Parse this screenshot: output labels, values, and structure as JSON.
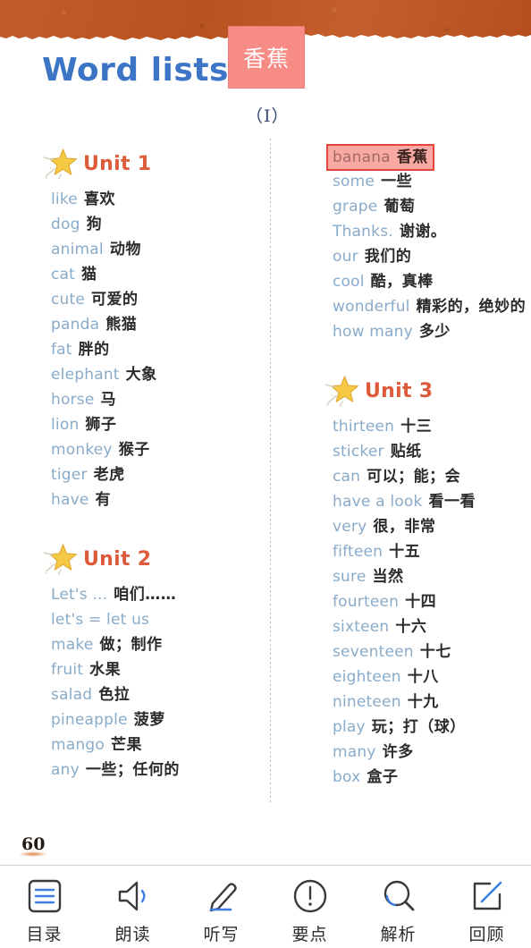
{
  "header": {
    "title": "Word lists",
    "volume_marker": "（Ⅰ）",
    "band_color": "#bc5627",
    "title_color": "#3c74c6"
  },
  "tooltip": {
    "text": "香蕉",
    "bg_color": "#f78c86",
    "text_color": "#ffffff"
  },
  "page": {
    "number": "60"
  },
  "columns": {
    "left": [
      {
        "unit_label": "Unit 1",
        "star_icon": "star-icon",
        "words": [
          {
            "en": "like",
            "zh": "喜欢"
          },
          {
            "en": "dog",
            "zh": "狗"
          },
          {
            "en": "animal",
            "zh": "动物"
          },
          {
            "en": "cat",
            "zh": "猫"
          },
          {
            "en": "cute",
            "zh": "可爱的"
          },
          {
            "en": "panda",
            "zh": "熊猫"
          },
          {
            "en": "fat",
            "zh": "胖的"
          },
          {
            "en": "elephant",
            "zh": "大象"
          },
          {
            "en": "horse",
            "zh": "马"
          },
          {
            "en": "lion",
            "zh": "狮子"
          },
          {
            "en": "monkey",
            "zh": "猴子"
          },
          {
            "en": "tiger",
            "zh": "老虎"
          },
          {
            "en": "have",
            "zh": "有"
          }
        ]
      },
      {
        "unit_label": "Unit 2",
        "star_icon": "star-icon",
        "words": [
          {
            "en": "Let's ...",
            "zh": "咱们……"
          },
          {
            "en": "let's = let us",
            "zh": ""
          },
          {
            "en": "make",
            "zh": "做；制作"
          },
          {
            "en": "fruit",
            "zh": "水果"
          },
          {
            "en": "salad",
            "zh": "色拉"
          },
          {
            "en": "pineapple",
            "zh": "菠萝"
          },
          {
            "en": "mango",
            "zh": "芒果"
          },
          {
            "en": "any",
            "zh": "一些；任何的"
          }
        ]
      }
    ],
    "right": [
      {
        "unit_label": "",
        "star_icon": "",
        "words": [
          {
            "en": "banana",
            "zh": "香蕉",
            "highlighted": true
          },
          {
            "en": "some",
            "zh": "一些"
          },
          {
            "en": "grape",
            "zh": "葡萄"
          },
          {
            "en": "Thanks.",
            "zh": "谢谢。"
          },
          {
            "en": "our",
            "zh": "我们的"
          },
          {
            "en": "cool",
            "zh": "酷，真棒"
          },
          {
            "en": "wonderful",
            "zh": "精彩的，绝妙的"
          },
          {
            "en": "how many",
            "zh": "多少"
          }
        ]
      },
      {
        "unit_label": "Unit 3",
        "star_icon": "star-icon",
        "words": [
          {
            "en": "thirteen",
            "zh": "十三"
          },
          {
            "en": "sticker",
            "zh": "贴纸"
          },
          {
            "en": "can",
            "zh": "可以；能；会"
          },
          {
            "en": "have a look",
            "zh": "看一看"
          },
          {
            "en": "very",
            "zh": "很，非常"
          },
          {
            "en": "fifteen",
            "zh": "十五"
          },
          {
            "en": "sure",
            "zh": "当然"
          },
          {
            "en": "fourteen",
            "zh": "十四"
          },
          {
            "en": "sixteen",
            "zh": "十六"
          },
          {
            "en": "seventeen",
            "zh": "十七"
          },
          {
            "en": "eighteen",
            "zh": "十八"
          },
          {
            "en": "nineteen",
            "zh": "十九"
          },
          {
            "en": "play",
            "zh": "玩；打（球）"
          },
          {
            "en": "many",
            "zh": "许多"
          },
          {
            "en": "box",
            "zh": "盒子"
          }
        ]
      }
    ]
  },
  "toolbar": {
    "items": [
      {
        "label": "目录",
        "icon": "list-contents-icon"
      },
      {
        "label": "朗读",
        "icon": "speaker-icon"
      },
      {
        "label": "听写",
        "icon": "pencil-icon"
      },
      {
        "label": "要点",
        "icon": "exclamation-circle-icon"
      },
      {
        "label": "解析",
        "icon": "magnifier-icon"
      },
      {
        "label": "回顾",
        "icon": "edit-square-icon"
      }
    ]
  }
}
